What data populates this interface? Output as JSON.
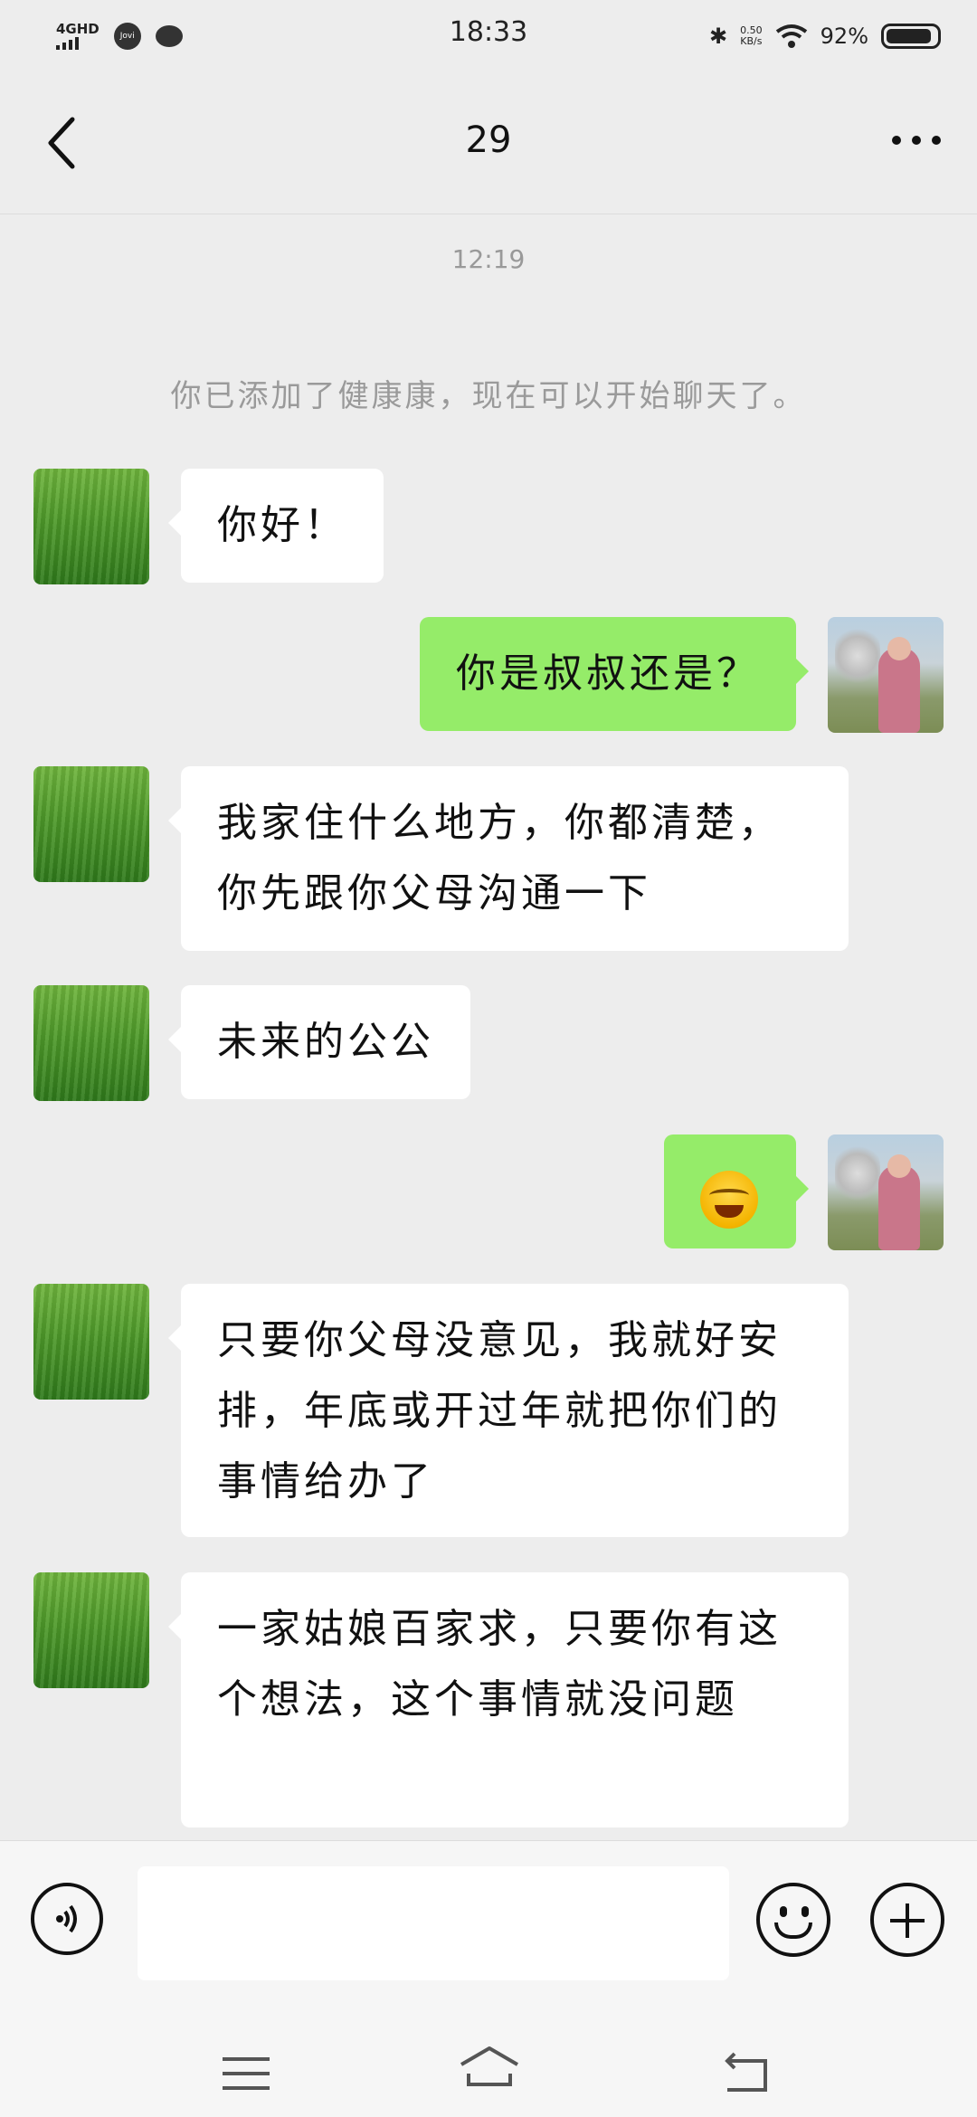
{
  "status_bar": {
    "time": "18:33",
    "signal": "4GHD",
    "jovi": "Jovi",
    "speed_value": "0.50",
    "speed_unit": "KB/s",
    "battery": "92%"
  },
  "header": {
    "title": "29"
  },
  "chat": {
    "timestamp": "12:19",
    "system_message": "你已添加了健康康，现在可以开始聊天了。",
    "messages": [
      {
        "side": "left",
        "text": "你好！"
      },
      {
        "side": "right",
        "text": "你是叔叔还是？"
      },
      {
        "side": "left",
        "text": "我家住什么地方，你都清楚，你先跟你父母沟通一下"
      },
      {
        "side": "left",
        "text": "未来的公公"
      },
      {
        "side": "right",
        "emoji": "laugh-cry-emoji"
      },
      {
        "side": "left",
        "text": "只要你父母没意见，我就好安排，年底或开过年就把你们的事情给办了"
      },
      {
        "side": "left",
        "text": "一家姑娘百家求，只要你有这个想法，这个事情就没问题"
      }
    ]
  },
  "input_bar": {
    "placeholder": "",
    "icons": [
      "voice-icon",
      "emoji-icon",
      "plus-icon"
    ]
  },
  "colors": {
    "sent_bubble": "#95ec69",
    "received_bubble": "#ffffff",
    "background": "#ededed"
  }
}
